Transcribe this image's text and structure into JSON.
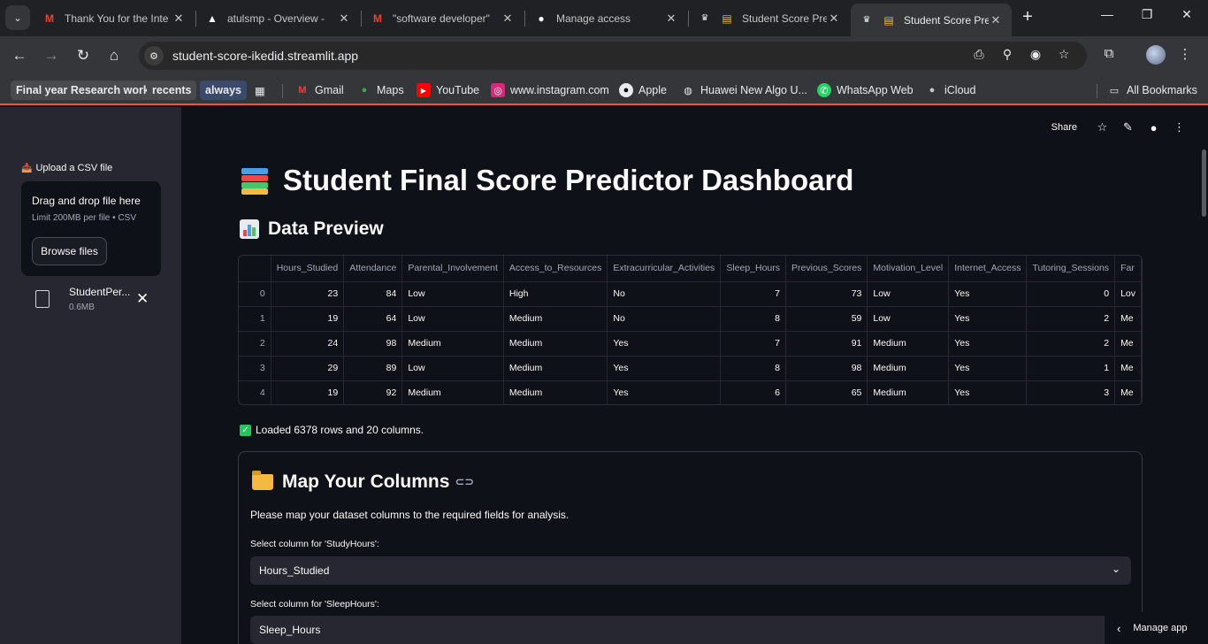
{
  "browser": {
    "tabs": [
      {
        "title": "Thank You for the Inte",
        "favicon": "gmail-icon",
        "active": false
      },
      {
        "title": "atulsmp - Overview -",
        "favicon": "vercel-icon",
        "active": false
      },
      {
        "title": "\"software developer\" ",
        "favicon": "gmail-icon",
        "active": false
      },
      {
        "title": "Manage access",
        "favicon": "github-icon",
        "active": false
      },
      {
        "title": "Student Score Pre",
        "favicon": "books-icon",
        "active": false
      },
      {
        "title": "Student Score Pre",
        "favicon": "books-icon",
        "active": true
      }
    ],
    "url": "student-score-ikedid.streamlit.app",
    "bookmarks": [
      "Final year Research work",
      "recents",
      "always",
      "Gmail",
      "Maps",
      "YouTube",
      "www.instagram.com",
      "Apple",
      "Huawei New Algo U...",
      "WhatsApp Web",
      "iCloud"
    ],
    "all_bookmarks": "All Bookmarks"
  },
  "sidebar": {
    "upload_label": "Upload a CSV file",
    "dropzone_title": "Drag and drop file here",
    "dropzone_limit": "Limit 200MB per file • CSV",
    "browse_button": "Browse files",
    "file_name": "StudentPer...",
    "file_size": "0.6MB"
  },
  "header": {
    "share": "Share"
  },
  "main": {
    "title": "Student Final Score Predictor Dashboard",
    "preview_heading": "Data Preview",
    "table": {
      "columns": [
        "",
        "Hours_Studied",
        "Attendance",
        "Parental_Involvement",
        "Access_to_Resources",
        "Extracurricular_Activities",
        "Sleep_Hours",
        "Previous_Scores",
        "Motivation_Level",
        "Internet_Access",
        "Tutoring_Sessions",
        "Far"
      ],
      "rows": [
        [
          "0",
          "23",
          "84",
          "Low",
          "High",
          "No",
          "7",
          "73",
          "Low",
          "Yes",
          "0",
          "Lov"
        ],
        [
          "1",
          "19",
          "64",
          "Low",
          "Medium",
          "No",
          "8",
          "59",
          "Low",
          "Yes",
          "2",
          "Me"
        ],
        [
          "2",
          "24",
          "98",
          "Medium",
          "Medium",
          "Yes",
          "7",
          "91",
          "Medium",
          "Yes",
          "2",
          "Me"
        ],
        [
          "3",
          "29",
          "89",
          "Low",
          "Medium",
          "Yes",
          "8",
          "98",
          "Medium",
          "Yes",
          "1",
          "Me"
        ],
        [
          "4",
          "19",
          "92",
          "Medium",
          "Medium",
          "Yes",
          "6",
          "65",
          "Medium",
          "Yes",
          "3",
          "Me"
        ]
      ]
    },
    "success_message": "Loaded 6378 rows and 20 columns.",
    "map_title": "Map Your Columns",
    "map_description": "Please map your dataset columns to the required fields for analysis.",
    "selects": [
      {
        "label": "Select column for 'StudyHours':",
        "value": "Hours_Studied"
      },
      {
        "label": "Select column for 'SleepHours':",
        "value": "Sleep_Hours"
      }
    ],
    "manage_app": "Manage app"
  }
}
